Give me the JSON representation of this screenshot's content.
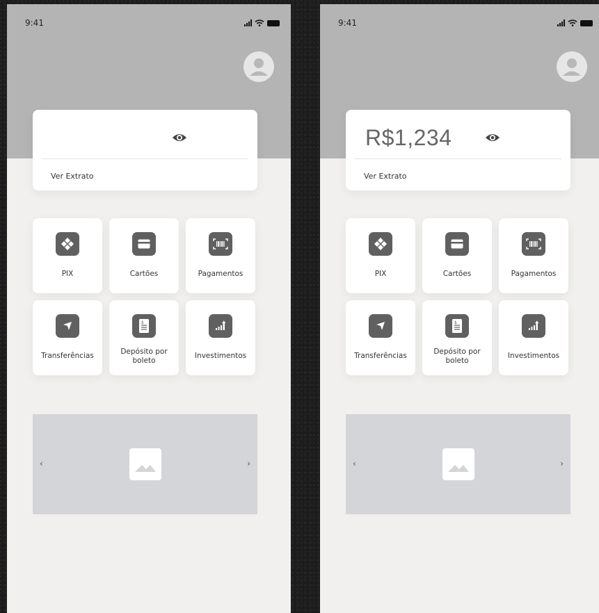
{
  "screens": [
    {
      "status_time": "9:41",
      "balance": "",
      "extrato_label": "Ver Extrato",
      "actions": [
        "PIX",
        "Cartões",
        "Pagamentos",
        "Transferências",
        "Depósito por boleto",
        "Investimentos"
      ],
      "banner": {
        "prev": "‹",
        "next": "›"
      }
    },
    {
      "status_time": "9:41",
      "balance": "R$1,234",
      "extrato_label": "Ver Extrato",
      "actions": [
        "PIX",
        "Cartões",
        "Pagamentos",
        "Transferências",
        "Depósito por boleto",
        "Investimentos"
      ],
      "banner": {
        "prev": "‹",
        "next": "›"
      }
    }
  ],
  "icons": {
    "pix": "pix-icon",
    "cards": "card-icon",
    "payments": "barcode-icon",
    "transfers": "send-icon",
    "boleto": "document-icon",
    "investments": "chart-up-icon",
    "eye": "eye-icon",
    "avatar": "user-avatar-icon",
    "banner_image": "image-placeholder-icon"
  },
  "colors": {
    "header": "#b4b4b4",
    "background": "#f1f0ee",
    "icon_tile": "#606060",
    "banner": "#d4d5d8"
  }
}
